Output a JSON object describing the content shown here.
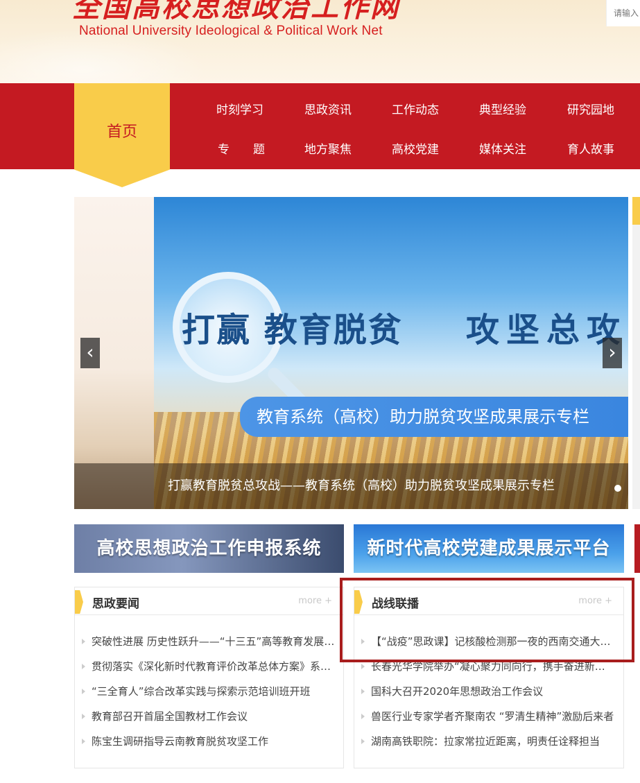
{
  "header": {
    "title_cn": "全国高校思想政治工作网",
    "title_en": "National University Ideological & Political Work Net",
    "search_placeholder": "请输入"
  },
  "nav": {
    "home": "首页",
    "row1": [
      "时刻学习",
      "思政资讯",
      "工作动态",
      "典型经验",
      "研究园地"
    ],
    "row2": [
      "专　　题",
      "地方聚焦",
      "高校党建",
      "媒体关注",
      "育人故事"
    ]
  },
  "banner": {
    "headline_a": "打赢",
    "headline_b": "教育脱贫",
    "headline_c": "攻坚总攻",
    "subtitle": "教育系统（高校）助力脱贫攻坚成果展示专栏",
    "caption": "打赢教育脱贫总攻战——教育系统（高校）助力脱贫攻坚成果展示专栏",
    "prev_icon": "‹",
    "next_icon": "›"
  },
  "platforms": {
    "left": "高校思想政治工作申报系统",
    "right": "新时代高校党建成果展示平台"
  },
  "panels": {
    "left": {
      "title": "思政要闻",
      "more": "more +",
      "items": [
        "突破性进展 历史性跃升——“十三五”高等教育发展成就",
        "贯彻落实《深化新时代教育评价改革总体方案》系列解读",
        "“三全育人”综合改革实践与探索示范培训班开班",
        "教育部召开首届全国教材工作会议",
        "陈宝生调研指导云南教育脱贫攻坚工作"
      ]
    },
    "right": {
      "title": "战线联播",
      "more": "more +",
      "items": [
        "【“战疫”思政课】记核酸检测那一夜的西南交通大学师生",
        "长春光华学院举办“凝心聚力同向行，携手奋进新征程”活动",
        "国科大召开2020年思想政治工作会议",
        "兽医行业专家学者齐聚南农 “罗清生精神”激励后来者",
        "湖南高铁职院：拉家常拉近距离，明责任诠释担当"
      ]
    }
  }
}
